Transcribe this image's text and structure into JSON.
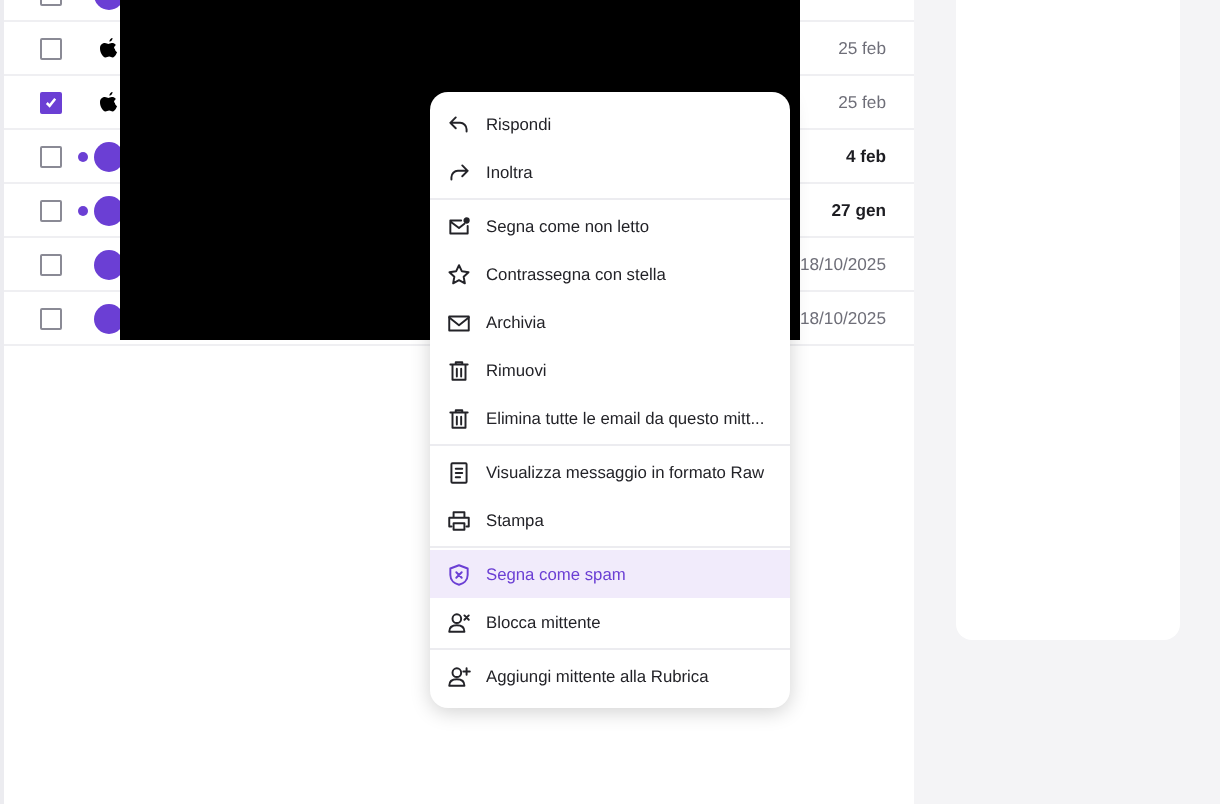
{
  "messages": [
    {
      "kind": "yahoo",
      "unread": false,
      "checked": false
    },
    {
      "kind": "apple",
      "unread": false,
      "checked": false,
      "date": "25 feb"
    },
    {
      "kind": "apple",
      "unread": false,
      "checked": true,
      "date": "25 feb"
    },
    {
      "kind": "yahoo",
      "unread": true,
      "checked": false,
      "date": "4 feb"
    },
    {
      "kind": "yahoo",
      "unread": true,
      "checked": false,
      "date": "27 gen"
    },
    {
      "kind": "yahoo",
      "unread": false,
      "checked": false,
      "date": "18/10/2025"
    },
    {
      "kind": "yahoo",
      "unread": false,
      "checked": false,
      "date": "18/10/2025"
    }
  ],
  "context_menu": {
    "sections": [
      [
        {
          "label": "Rispondi",
          "kind": "reply",
          "selected": false
        },
        {
          "label": "Inoltra",
          "kind": "forward",
          "selected": false
        }
      ],
      [
        {
          "label": "Segna come non letto",
          "kind": "unread",
          "selected": false
        },
        {
          "label": "Contrassegna con stella",
          "kind": "star",
          "selected": false
        },
        {
          "label": "Archivia",
          "kind": "archive",
          "selected": false
        },
        {
          "label": "Rimuovi",
          "kind": "trash",
          "selected": false
        },
        {
          "label": "Elimina tutte le email da questo mitt...",
          "kind": "trash",
          "selected": false
        }
      ],
      [
        {
          "label": "Visualizza messaggio in formato Raw",
          "kind": "doc",
          "selected": false
        },
        {
          "label": "Stampa",
          "kind": "print",
          "selected": false
        }
      ],
      [
        {
          "label": "Segna come spam",
          "kind": "spam",
          "selected": true
        },
        {
          "label": "Blocca mittente",
          "kind": "block",
          "selected": false
        }
      ],
      [
        {
          "label": "Aggiungi mittente alla Rubrica",
          "kind": "addperson",
          "selected": false
        }
      ]
    ]
  }
}
